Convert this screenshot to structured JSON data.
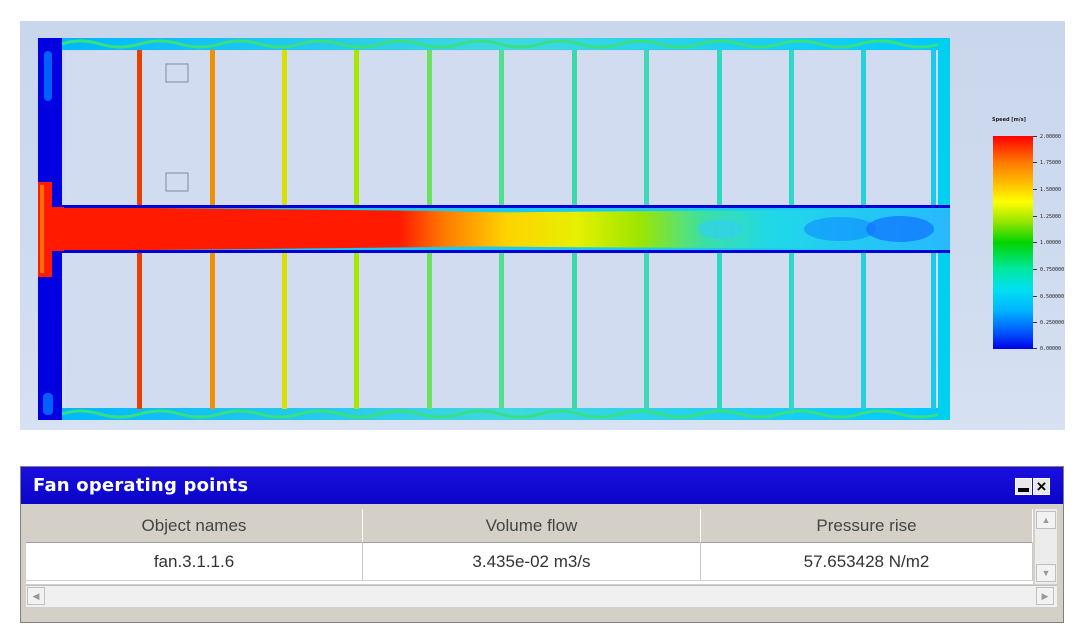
{
  "legend": {
    "title": "Speed [m/s]",
    "ticks": [
      "2.00000",
      "1.75000",
      "1.50000",
      "1.25000",
      "1.00000",
      "0.750000",
      "0.500000",
      "0.250000",
      "0.00000"
    ]
  },
  "window": {
    "title": "Fan operating points",
    "columns": [
      "Object names",
      "Volume flow",
      "Pressure rise"
    ],
    "row": [
      "fan.3.1.1.6",
      "3.435e-02 m3/s",
      "57.653428 N/m2"
    ]
  },
  "colors": {
    "titlebar": "#0a05c8",
    "jet_core": "#ff1a00",
    "enclosure_outline": "#0000e6"
  }
}
